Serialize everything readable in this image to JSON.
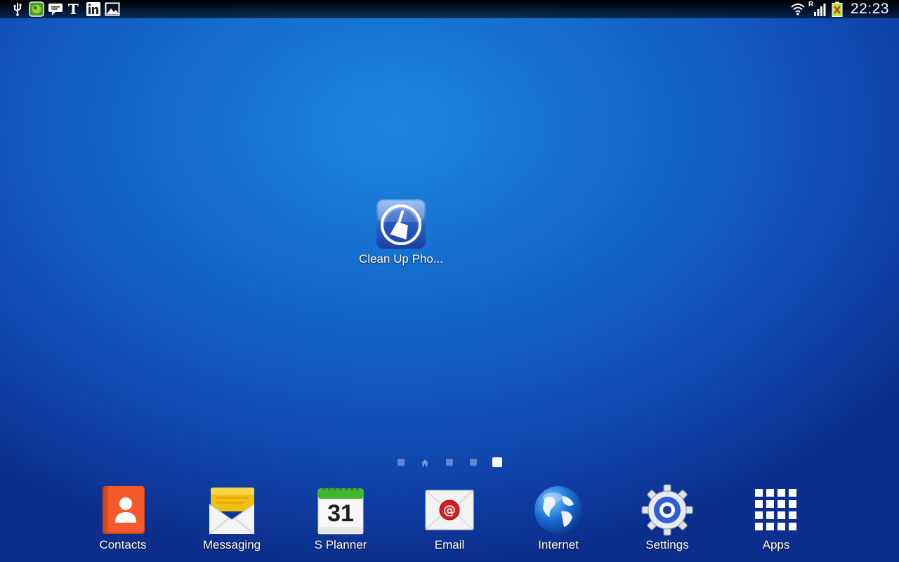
{
  "status_bar": {
    "left_icons": [
      "usb-icon",
      "game-icon",
      "chat-icon",
      "nytimes-icon",
      "linkedin-icon",
      "gallery-icon"
    ],
    "right_icons": [
      "wifi-icon",
      "signal-icon",
      "battery-icon"
    ],
    "signal_roaming": "R",
    "time": "22:23"
  },
  "desktop": {
    "shortcut_label": "Clean Up Pho..."
  },
  "pager": {
    "pages": 5,
    "current": 5
  },
  "dock": {
    "contacts": "Contacts",
    "messaging": "Messaging",
    "splanner": "S Planner",
    "splanner_date": "31",
    "email": "Email",
    "internet": "Internet",
    "settings": "Settings",
    "apps": "Apps"
  },
  "colors": {
    "wallpaper": "#1670cf",
    "contacts": "#f0521e",
    "planner_green": "#3fb82c",
    "email_red": "#d42020"
  }
}
